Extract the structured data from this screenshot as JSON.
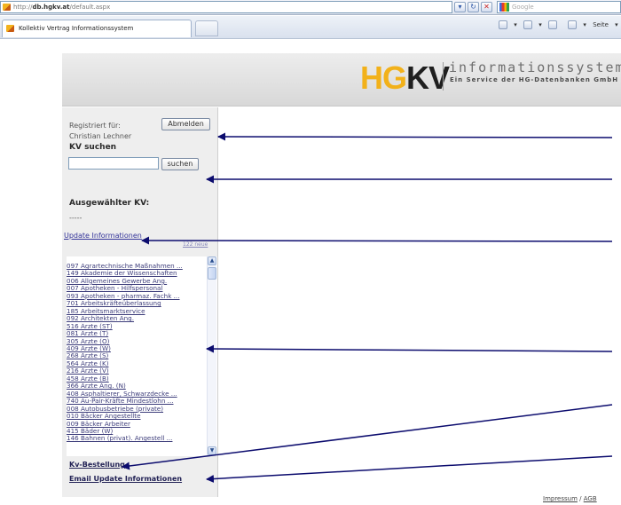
{
  "browser": {
    "address_prefix": "http://",
    "address_domain": "db.hgkv.at",
    "address_path": "/default.aspx",
    "search_placeholder": "Google",
    "tab_title": "Kollektiv Vertrag Informationssystem",
    "tools_page_label": "Seite"
  },
  "header": {
    "logo_hg": "HG",
    "logo_kv": "KV",
    "title": "informationssystem",
    "subtitle": "Ein Service der HG-Datenbanken GmbH"
  },
  "sidebar": {
    "registered_label": "Registriert für:",
    "user_name": "Christian Lechner",
    "logout_button": "Abmelden",
    "search_heading": "KV suchen",
    "search_value": "",
    "search_button": "suchen",
    "selected_heading": "Ausgewählter KV:",
    "selected_value": "-----",
    "update_link": "Update Informationen",
    "update_extra": "122 neue",
    "kv_items": [
      "097 Agrartechnische Maßnahmen ...",
      "149 Akademie der Wissenschaften",
      "006 Allgemeines Gewerbe Ang.",
      "007 Apotheken - Hilfspersonal",
      "093 Apotheken - pharmaz. Fachk ...",
      "701 Arbeitskräfteüberlassung",
      "185 Arbeitsmarktservice",
      "092 Architekten Ang.",
      "516 Ärzte (ST)",
      "081 Ärzte (T)",
      "305 Ärzte (O)",
      "409 Ärzte (W)",
      "268 Ärzte (S)",
      "564 Ärzte (K)",
      "216 Ärzte (V)",
      "458 Ärzte (B)",
      "366 Ärzte Ang. (N)",
      "408 Asphaltierer, Schwarzdecke ...",
      "740 Au-Pair-Kräfte Mindestlohn ...",
      "008 Autobusbetriebe (private)",
      "010 Bäcker Angestellte",
      "009 Bäcker Arbeiter",
      "415 Bäder (W)",
      "146 Bahnen (privat). Angestell ..."
    ],
    "order_link": "Kv-Bestellung",
    "email_link": "Email Update Informationen"
  },
  "footer": {
    "impressum": "Impressum",
    "separator": " / ",
    "agb": "AGB"
  },
  "colors": {
    "logo_accent": "#f2b11a",
    "arrow": "#0c0c6e",
    "sidebar_bg": "#eeeeee",
    "header_bg": "#dedede"
  }
}
